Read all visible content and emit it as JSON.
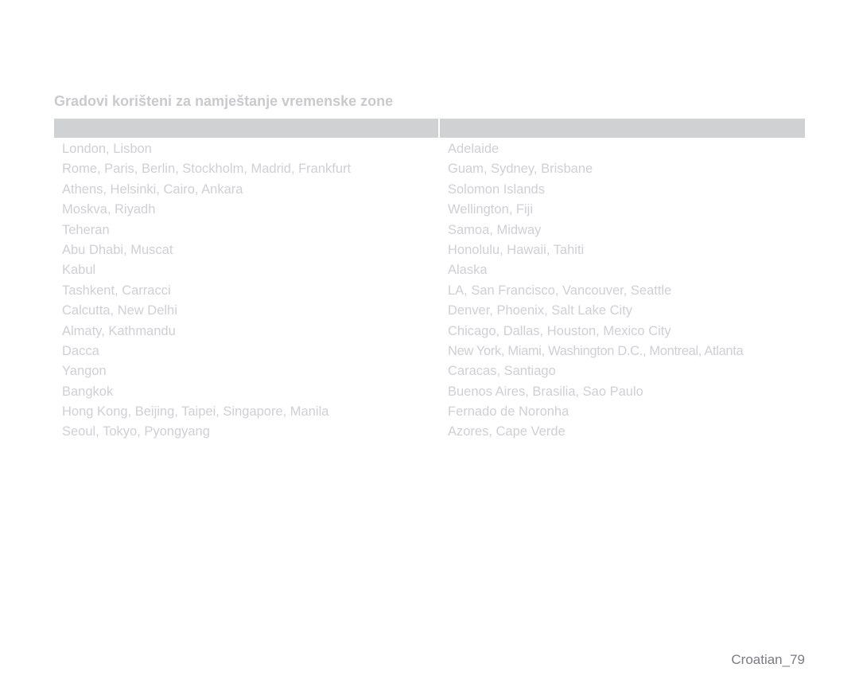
{
  "page": {
    "title": "Gradovi korišteni za namještanje vremenske zone",
    "footer": "Croatian_79"
  },
  "table": {
    "headers": [
      "",
      ""
    ],
    "left_column": [
      "London, Lisbon",
      "Rome, Paris, Berlin, Stockholm, Madrid, Frankfurt",
      "Athens, Helsinki, Cairo, Ankara",
      "Moskva, Riyadh",
      "Teheran",
      "Abu Dhabi, Muscat",
      "Kabul",
      "Tashkent, Carracci",
      "Calcutta, New Delhi",
      "Almaty, Kathmandu",
      "Dacca",
      "Yangon",
      "Bangkok",
      "Hong Kong, Beijing, Taipei, Singapore, Manila",
      "Seoul, Tokyo, Pyongyang"
    ],
    "right_column": [
      "Adelaide",
      "Guam, Sydney, Brisbane",
      "Solomon Islands",
      "Wellington, Fiji",
      "Samoa, Midway",
      "Honolulu, Hawaii, Tahiti",
      "Alaska",
      "LA, San Francisco, Vancouver, Seattle",
      "Denver, Phoenix, Salt Lake City",
      "Chicago, Dallas, Houston, Mexico City",
      "New York, Miami, Washington D.C., Montreal, Atlanta",
      "Caracas, Santiago",
      "Buenos Aires, Brasilia, Sao Paulo",
      "Fernado de Noronha",
      "Azores, Cape Verde"
    ]
  },
  "colors": {
    "title": "#c9cacd",
    "header_bar": "#d0d1d3",
    "cell_text": "#cfd0d3",
    "footer_text": "#7a7c82"
  }
}
